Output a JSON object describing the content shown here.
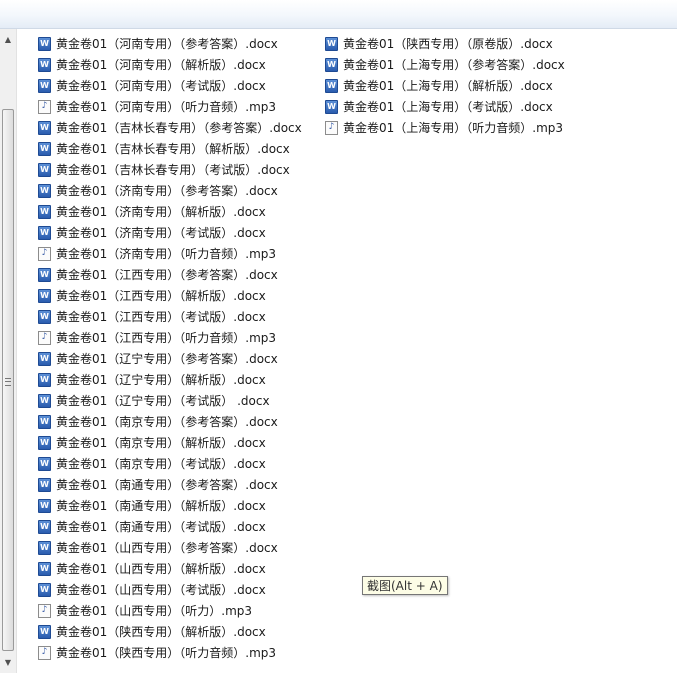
{
  "icons": {
    "docx": {
      "name": "word-document-icon",
      "glyph": "W"
    },
    "mp3": {
      "name": "audio-file-icon",
      "glyph": "♪"
    }
  },
  "scrollbar": {
    "up_glyph": "▲",
    "down_glyph": "▼"
  },
  "files_col1": [
    {
      "name": "黄金卷01（河南专用）（参考答案）.docx",
      "type": "docx"
    },
    {
      "name": "黄金卷01（河南专用）（解析版）.docx",
      "type": "docx"
    },
    {
      "name": "黄金卷01（河南专用）（考试版）.docx",
      "type": "docx"
    },
    {
      "name": "黄金卷01（河南专用）（听力音频）.mp3",
      "type": "mp3"
    },
    {
      "name": "黄金卷01（吉林长春专用）（参考答案）.docx",
      "type": "docx"
    },
    {
      "name": "黄金卷01（吉林长春专用）（解析版）.docx",
      "type": "docx"
    },
    {
      "name": "黄金卷01（吉林长春专用）（考试版）.docx",
      "type": "docx"
    },
    {
      "name": "黄金卷01（济南专用）（参考答案）.docx",
      "type": "docx"
    },
    {
      "name": "黄金卷01（济南专用）（解析版）.docx",
      "type": "docx"
    },
    {
      "name": "黄金卷01（济南专用）（考试版）.docx",
      "type": "docx"
    },
    {
      "name": "黄金卷01（济南专用）（听力音频）.mp3",
      "type": "mp3"
    },
    {
      "name": "黄金卷01（江西专用）（参考答案）.docx",
      "type": "docx"
    },
    {
      "name": "黄金卷01（江西专用）（解析版）.docx",
      "type": "docx"
    },
    {
      "name": "黄金卷01（江西专用）（考试版）.docx",
      "type": "docx"
    },
    {
      "name": "黄金卷01（江西专用）（听力音频）.mp3",
      "type": "mp3"
    },
    {
      "name": "黄金卷01（辽宁专用）（参考答案）.docx",
      "type": "docx"
    },
    {
      "name": "黄金卷01（辽宁专用）（解析版）.docx",
      "type": "docx"
    },
    {
      "name": "黄金卷01（辽宁专用）（考试版） .docx",
      "type": "docx"
    },
    {
      "name": "黄金卷01（南京专用）（参考答案）.docx",
      "type": "docx"
    },
    {
      "name": "黄金卷01（南京专用）（解析版）.docx",
      "type": "docx"
    },
    {
      "name": "黄金卷01（南京专用）（考试版）.docx",
      "type": "docx"
    },
    {
      "name": "黄金卷01（南通专用）（参考答案）.docx",
      "type": "docx"
    },
    {
      "name": "黄金卷01（南通专用）（解析版）.docx",
      "type": "docx"
    },
    {
      "name": "黄金卷01（南通专用）（考试版）.docx",
      "type": "docx"
    },
    {
      "name": "黄金卷01（山西专用）（参考答案）.docx",
      "type": "docx"
    },
    {
      "name": "黄金卷01（山西专用）（解析版）.docx",
      "type": "docx"
    },
    {
      "name": "黄金卷01（山西专用）（考试版）.docx",
      "type": "docx"
    },
    {
      "name": "黄金卷01（山西专用）（听力）.mp3",
      "type": "mp3"
    },
    {
      "name": "黄金卷01（陕西专用）（解析版）.docx",
      "type": "docx"
    },
    {
      "name": "黄金卷01（陕西专用）（听力音频）.mp3",
      "type": "mp3"
    }
  ],
  "files_col2": [
    {
      "name": "黄金卷01（陕西专用）（原卷版）.docx",
      "type": "docx"
    },
    {
      "name": "黄金卷01（上海专用）（参考答案）.docx",
      "type": "docx"
    },
    {
      "name": "黄金卷01（上海专用）（解析版）.docx",
      "type": "docx"
    },
    {
      "name": "黄金卷01（上海专用）（考试版）.docx",
      "type": "docx"
    },
    {
      "name": "黄金卷01（上海专用）（听力音频）.mp3",
      "type": "mp3"
    }
  ],
  "tooltip": {
    "text": "截图(Alt + A)"
  }
}
